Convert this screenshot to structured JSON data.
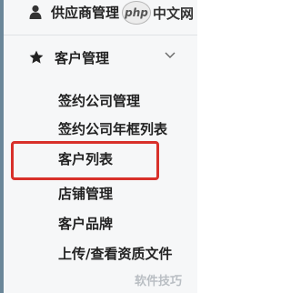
{
  "top_item": {
    "label": "供应商管理",
    "icon": "user-icon"
  },
  "watermark": {
    "logo_text": "php",
    "site_text": "中文网"
  },
  "menu_group": {
    "label": "客户管理",
    "icon": "star-icon",
    "expand_icon": "chevron-down-icon"
  },
  "sub_items": [
    {
      "label": "签约公司管理"
    },
    {
      "label": "签约公司年框列表"
    },
    {
      "label": "客户列表"
    },
    {
      "label": "店铺管理"
    },
    {
      "label": "客户品牌"
    },
    {
      "label": "上传/查看资质文件"
    }
  ],
  "highlighted_item": "客户列表",
  "colors": {
    "highlight_border": "#d8302a",
    "sidebar_bg": "#f6f7f8",
    "accent_strip": "#6b8799"
  },
  "bottom_watermark": "软件技巧"
}
